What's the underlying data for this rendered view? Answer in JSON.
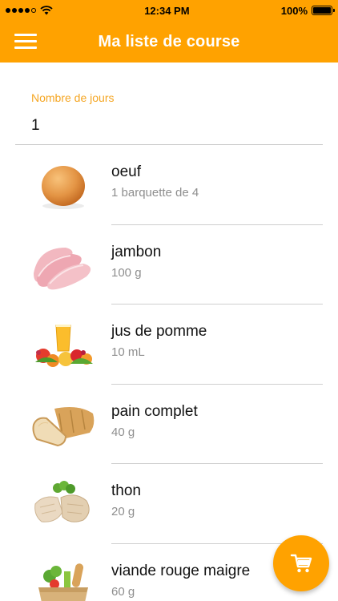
{
  "status_bar": {
    "time": "12:34 PM",
    "battery": "100%"
  },
  "nav": {
    "title": "Ma liste de course"
  },
  "days_field": {
    "label": "Nombre de jours",
    "value": "1"
  },
  "items": [
    {
      "name": "oeuf",
      "quantity": "1 barquette de 4",
      "icon": "egg-image"
    },
    {
      "name": "jambon",
      "quantity": "100 g",
      "icon": "ham-image"
    },
    {
      "name": "jus de pomme",
      "quantity": "10 mL",
      "icon": "apple-juice-image"
    },
    {
      "name": "pain complet",
      "quantity": "40 g",
      "icon": "bread-image"
    },
    {
      "name": "thon",
      "quantity": "20 g",
      "icon": "tuna-image"
    },
    {
      "name": "viande rouge maigre",
      "quantity": "60 g",
      "icon": "grocery-bag-image"
    }
  ],
  "colors": {
    "accent": "#FFA200",
    "label": "#F5A623",
    "secondary_text": "#8e8e8e"
  }
}
